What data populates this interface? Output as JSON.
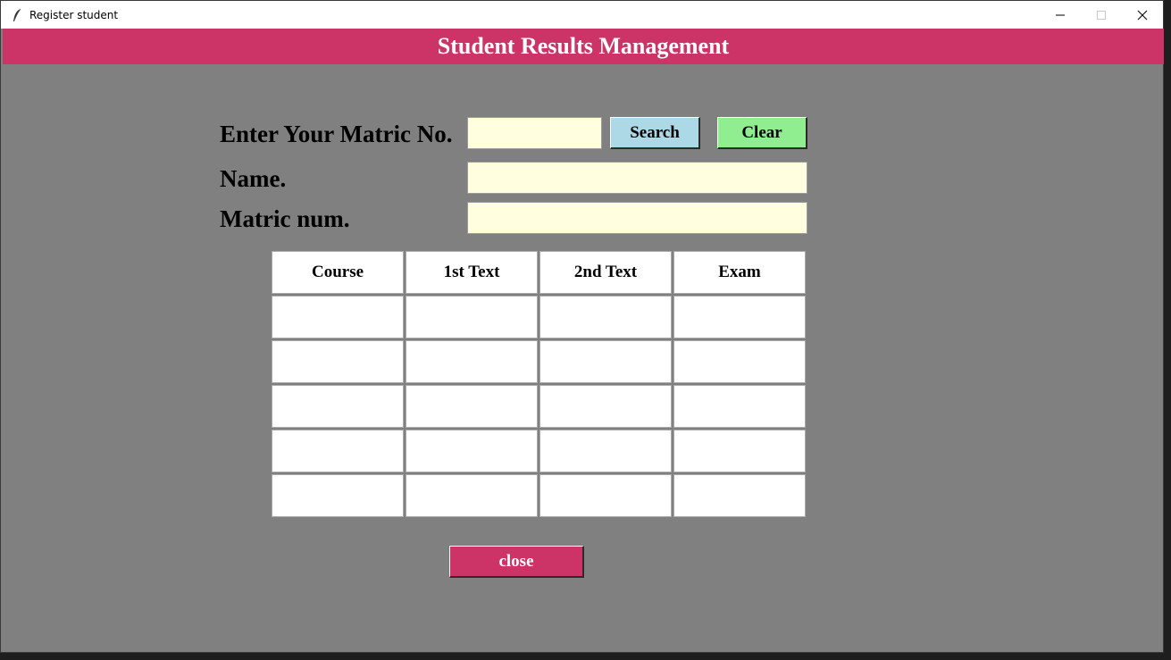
{
  "window": {
    "title": "Register student",
    "controls": [
      "minimize-icon",
      "maximize-icon",
      "close-icon"
    ]
  },
  "header": {
    "title": "Student Results Management",
    "color": "#cc3366"
  },
  "form": {
    "matric_label": "Enter Your Matric No.",
    "matric_value": "",
    "search_label": "Search",
    "clear_label": "Clear",
    "name_label": "Name.",
    "name_value": "",
    "matricnum_label": "Matric num.",
    "matricnum_value": ""
  },
  "table": {
    "headers": [
      "Course",
      "1st Text",
      "2nd Text",
      "Exam"
    ],
    "rows": [
      [
        "",
        "",
        "",
        ""
      ],
      [
        "",
        "",
        "",
        ""
      ],
      [
        "",
        "",
        "",
        ""
      ],
      [
        "",
        "",
        "",
        ""
      ],
      [
        "",
        "",
        "",
        ""
      ]
    ]
  },
  "footer": {
    "close_label": "close"
  },
  "colors": {
    "background": "#808080",
    "entry": "#ffffe0",
    "search_button": "#add8e6",
    "clear_button": "#90ee90",
    "close_button": "#cc3366"
  }
}
